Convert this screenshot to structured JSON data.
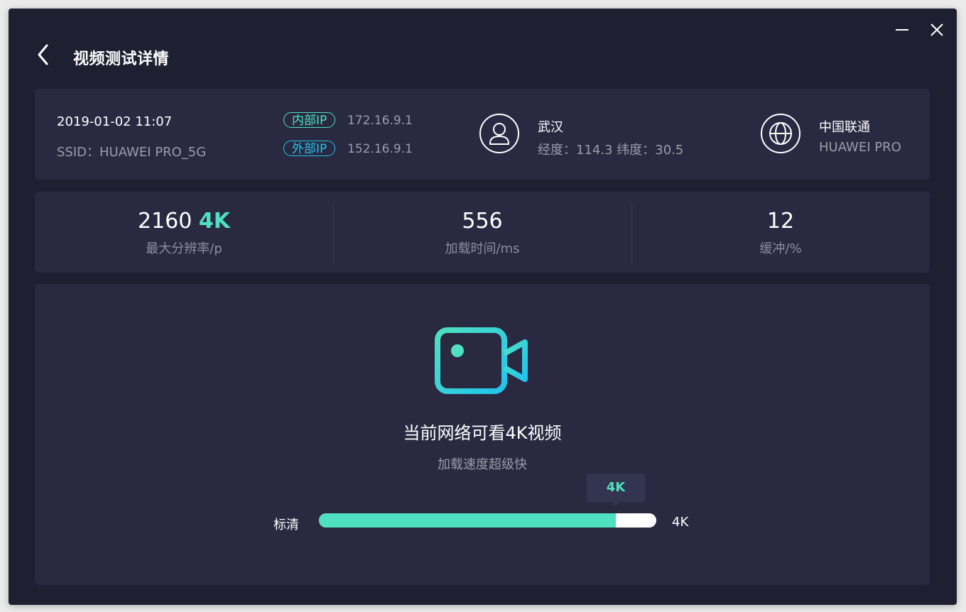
{
  "window": {
    "title": "视频测试详情",
    "controls": [
      "minimize-icon",
      "close-icon"
    ]
  },
  "info": {
    "datetime": "2019-01-02  11:07",
    "ssid": "SSID：HUAWEI PRO_5G",
    "inner_ip_label": "内部IP",
    "inner_ip": "172.16.9.1",
    "outer_ip_label": "外部IP",
    "outer_ip": "152.16.9.1",
    "city": "武汉",
    "coords": "经度：114.3   纬度：30.5",
    "isp": "中国联通",
    "device": "HUAWEI PRO"
  },
  "stats": [
    {
      "value": "2160",
      "accent": "4K",
      "label": "最大分辨率/p"
    },
    {
      "value": "556",
      "accent": "",
      "label": "加载时间/ms"
    },
    {
      "value": "12",
      "accent": "",
      "label": "缓冲/%"
    }
  ],
  "result": {
    "title": "当前网络可看4K视频",
    "subtitle": "加载速度超级快",
    "range_low": "标清",
    "range_high": "4K",
    "tooltip": "4K",
    "progress_fraction": 0.88
  },
  "colors": {
    "background": "#1e1f31",
    "card": "#292a41",
    "accent_green": "#4fe0c0",
    "accent_blue": "#20c4ee"
  }
}
